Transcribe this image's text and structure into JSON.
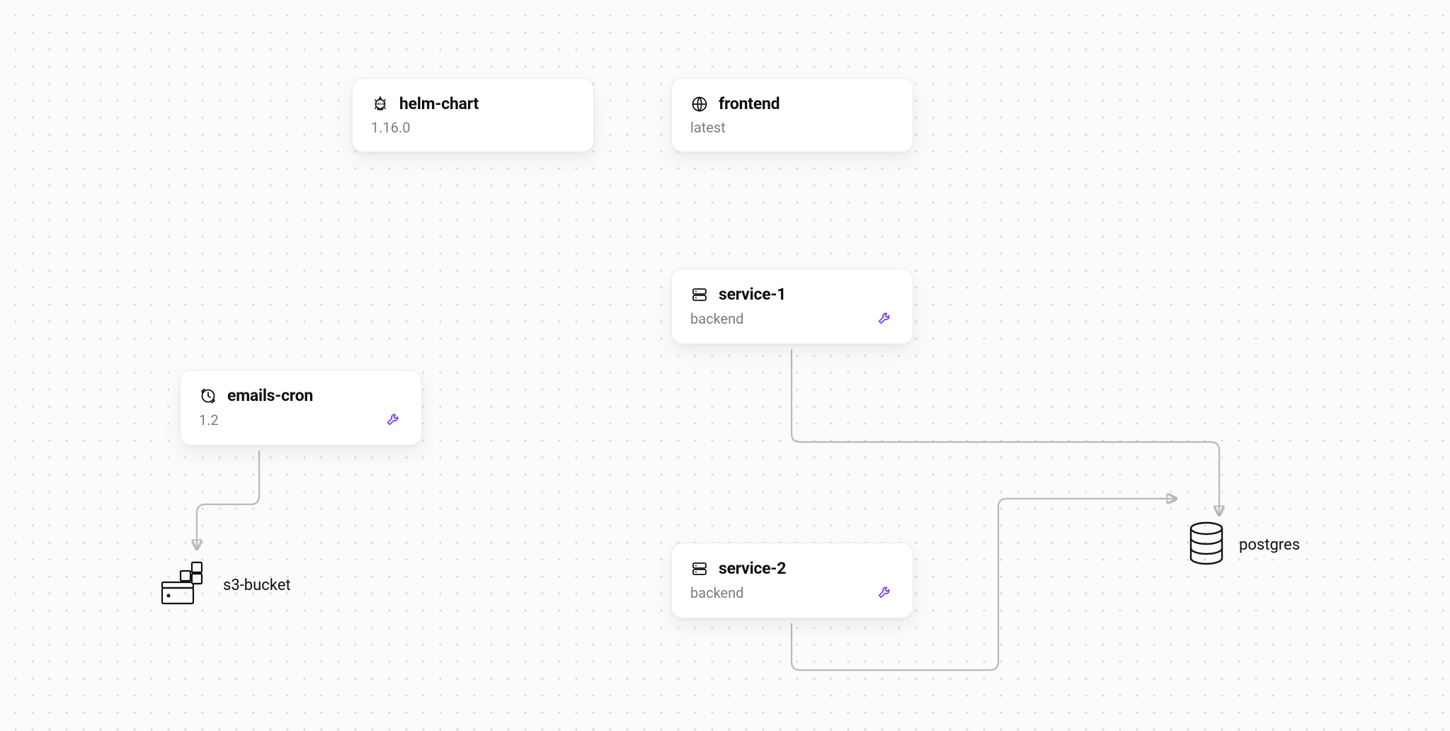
{
  "cards": {
    "helm": {
      "title": "helm-chart",
      "subtitle": "1.16.0"
    },
    "frontend": {
      "title": "frontend",
      "subtitle": "latest"
    },
    "service1": {
      "title": "service-1",
      "subtitle": "backend"
    },
    "emails": {
      "title": "emails-cron",
      "subtitle": "1.2"
    },
    "service2": {
      "title": "service-2",
      "subtitle": "backend"
    }
  },
  "resources": {
    "s3": {
      "label": "s3-bucket"
    },
    "postgres": {
      "label": "postgres"
    }
  }
}
